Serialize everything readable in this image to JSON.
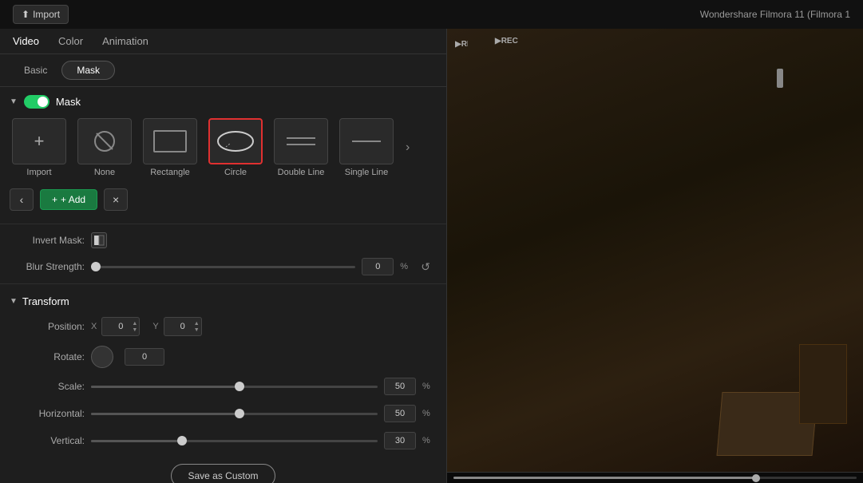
{
  "titleBar": {
    "importLabel": "Import",
    "appTitle": "Wondershare Filmora 11 (Filmora 1"
  },
  "tabs": {
    "video": "Video",
    "color": "Color",
    "animation": "Animation",
    "activeTab": "Video"
  },
  "subTabs": {
    "basic": "Basic",
    "mask": "Mask",
    "activeSubTab": "Mask"
  },
  "maskSection": {
    "title": "Mask",
    "toggleEnabled": true
  },
  "shapes": [
    {
      "id": "import",
      "label": "Import",
      "icon": "plus"
    },
    {
      "id": "none",
      "label": "None",
      "icon": "circle-slash"
    },
    {
      "id": "rectangle",
      "label": "Rectangle",
      "icon": "rect"
    },
    {
      "id": "circle",
      "label": "Circle",
      "icon": "ellipse",
      "selected": true
    },
    {
      "id": "double-line",
      "label": "Double Line",
      "icon": "double-line"
    },
    {
      "id": "single-line",
      "label": "Single Line",
      "icon": "single-line"
    }
  ],
  "addButton": {
    "label": "+ Add"
  },
  "invertMask": {
    "label": "Invert Mask:"
  },
  "blurStrength": {
    "label": "Blur Strength:",
    "value": "0",
    "unit": "%",
    "sliderPercent": 0
  },
  "transform": {
    "title": "Transform",
    "position": {
      "label": "Position:",
      "xLabel": "X",
      "xValue": "0",
      "yLabel": "Y",
      "yValue": "0"
    },
    "rotate": {
      "label": "Rotate:",
      "value": "0"
    },
    "scale": {
      "label": "Scale:",
      "value": "50",
      "unit": "%",
      "sliderPercent": 50
    },
    "horizontal": {
      "label": "Horizontal:",
      "value": "50",
      "unit": "%",
      "sliderPercent": 50
    },
    "vertical": {
      "label": "Vertical:",
      "value": "30",
      "unit": "%",
      "sliderPercent": 30
    }
  },
  "saveButton": {
    "label": "Save as Custom"
  },
  "recBadge": "REC"
}
